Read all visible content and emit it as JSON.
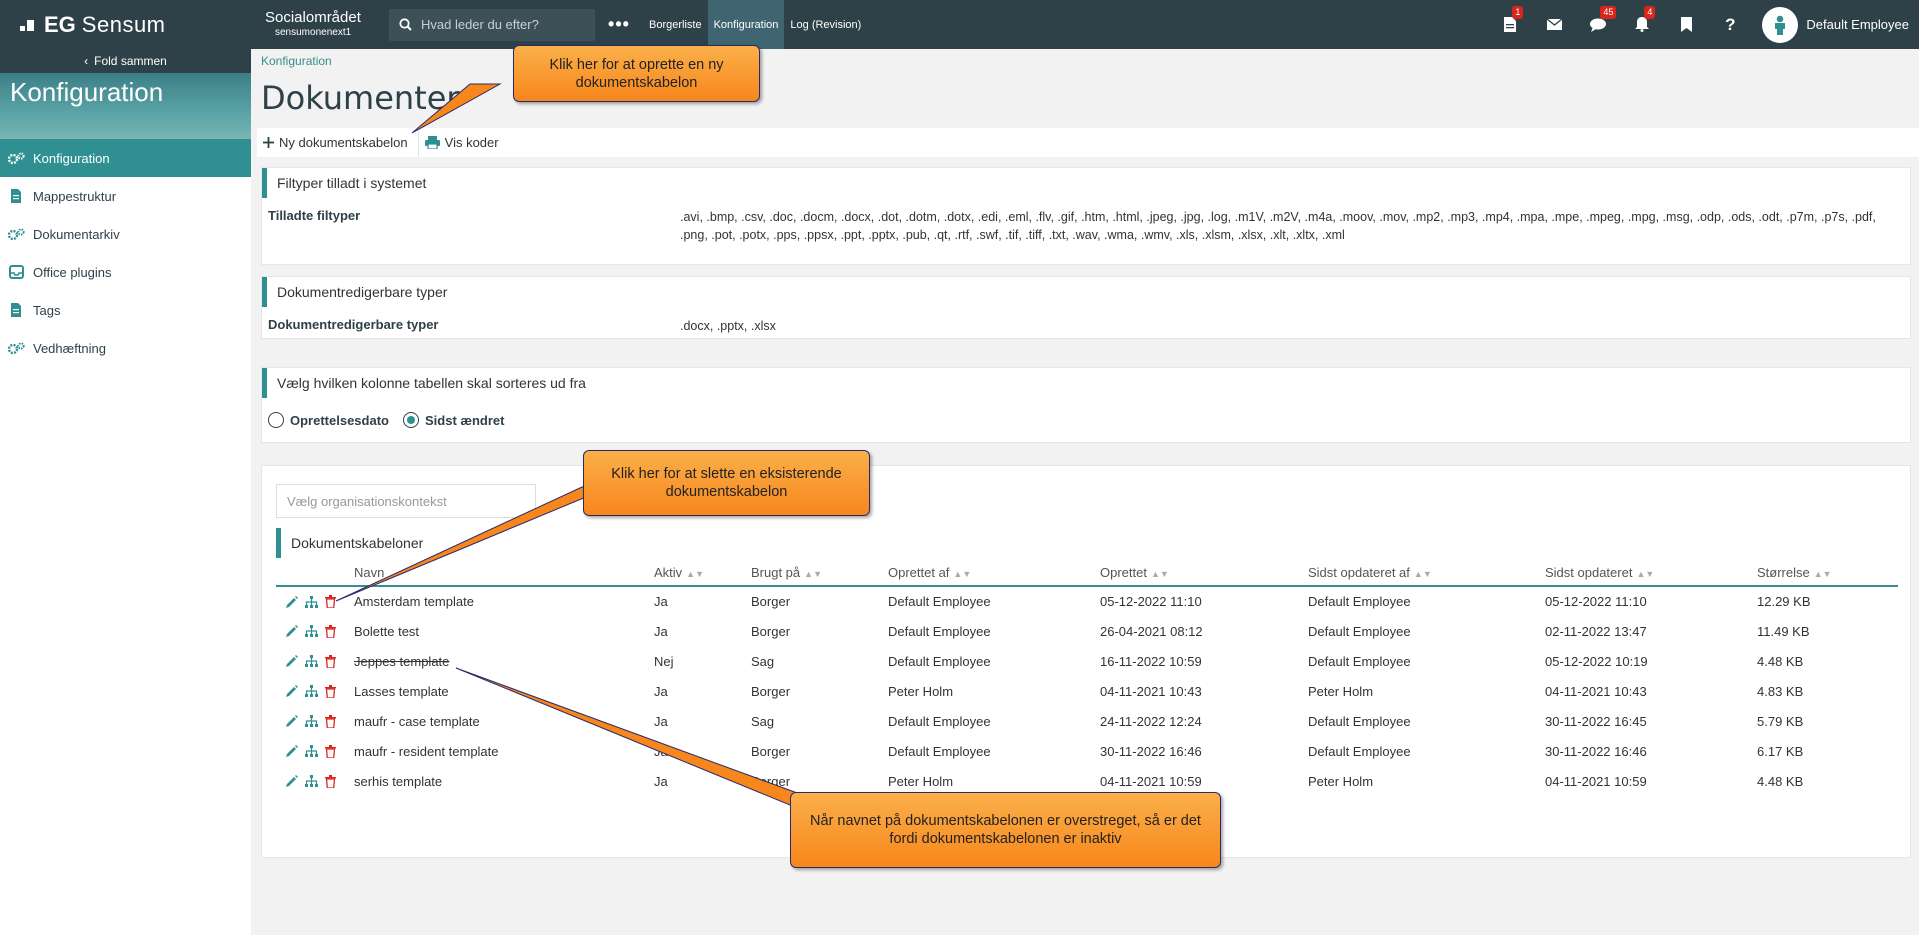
{
  "topbar": {
    "logo_eg": "EG",
    "logo_sensum": "Sensum",
    "org_title": "Socialområdet",
    "org_sub": "sensumonenext1",
    "search_placeholder": "Hvad leder du efter?",
    "more": "•••",
    "nav": [
      "Borgerliste",
      "Konfiguration",
      "Log (Revision)"
    ],
    "badges": {
      "docs": "1",
      "chat": "45",
      "bell": "4"
    },
    "user_name": "Default Employee"
  },
  "sidebar": {
    "fold_label": "Fold sammen",
    "banner_title": "Konfiguration",
    "items": [
      {
        "label": "Konfiguration",
        "icon": "gears-icon"
      },
      {
        "label": "Mappestruktur",
        "icon": "document-icon"
      },
      {
        "label": "Dokumentarkiv",
        "icon": "gears-icon"
      },
      {
        "label": "Office plugins",
        "icon": "inbox-icon"
      },
      {
        "label": "Tags",
        "icon": "document-icon"
      },
      {
        "label": "Vedhæftning",
        "icon": "gears-icon"
      }
    ]
  },
  "page": {
    "breadcrumb": "Konfiguration",
    "title": "Dokumenter",
    "toolbar": {
      "new_template": "Ny dokumentskabelon",
      "show_codes": "Vis koder"
    }
  },
  "filetypes": {
    "heading": "Filtyper tilladt i systemet",
    "label": "Tilladte filtyper",
    "value": ".avi, .bmp, .csv, .doc, .docm, .docx, .dot, .dotm, .dotx, .edi, .eml, .flv, .gif, .htm, .html, .jpeg, .jpg, .log, .m1V, .m2V, .m4a, .moov, .mov, .mp2, .mp3, .mp4, .mpa, .mpe, .mpeg, .mpg, .msg, .odp, .ods, .odt, .p7m, .p7s, .pdf, .png, .pot, .potx, .pps, .ppsx, .ppt, .pptx, .pub, .qt, .rtf, .swf, .tif, .tiff, .txt, .wav, .wma, .wmv, .xls, .xlsm, .xlsx, .xlt, .xltx, .xml"
  },
  "editable": {
    "heading": "Dokumentredigerbare typer",
    "label": "Dokumentredigerbare typer",
    "value": ".docx, .pptx, .xlsx"
  },
  "sorting": {
    "heading": "Vælg hvilken kolonne tabellen skal sorteres ud fra",
    "option1": "Oprettelsesdato",
    "option2": "Sidst ændret",
    "selected": "Sidst ændret"
  },
  "templates": {
    "org_placeholder": "Vælg organisationskontekst",
    "heading": "Dokumentskabeloner",
    "columns": [
      "Navn",
      "Aktiv",
      "Brugt på",
      "Oprettet af",
      "Oprettet",
      "Sidst opdateret af",
      "Sidst opdateret",
      "Størrelse"
    ],
    "rows": [
      {
        "name": "Amsterdam template",
        "active": "Ja",
        "used": "Borger",
        "created_by": "Default Employee",
        "created": "05-12-2022 11:10",
        "updated_by": "Default Employee",
        "updated": "05-12-2022 11:10",
        "size": "12.29 KB",
        "inactive": false
      },
      {
        "name": "Bolette test",
        "active": "Ja",
        "used": "Borger",
        "created_by": "Default Employee",
        "created": "26-04-2021 08:12",
        "updated_by": "Default Employee",
        "updated": "02-11-2022 13:47",
        "size": "11.49 KB",
        "inactive": false
      },
      {
        "name": "Jeppes template",
        "active": "Nej",
        "used": "Sag",
        "created_by": "Default Employee",
        "created": "16-11-2022 10:59",
        "updated_by": "Default Employee",
        "updated": "05-12-2022 10:19",
        "size": "4.48 KB",
        "inactive": true
      },
      {
        "name": "Lasses template",
        "active": "Ja",
        "used": "Borger",
        "created_by": "Peter Holm",
        "created": "04-11-2021 10:43",
        "updated_by": "Peter Holm",
        "updated": "04-11-2021 10:43",
        "size": "4.83 KB",
        "inactive": false
      },
      {
        "name": "maufr - case template",
        "active": "Ja",
        "used": "Sag",
        "created_by": "Default Employee",
        "created": "24-11-2022 12:24",
        "updated_by": "Default Employee",
        "updated": "30-11-2022 16:45",
        "size": "5.79 KB",
        "inactive": false
      },
      {
        "name": "maufr - resident template",
        "active": "Ja",
        "used": "Borger",
        "created_by": "Default Employee",
        "created": "30-11-2022 16:46",
        "updated_by": "Default Employee",
        "updated": "30-11-2022 16:46",
        "size": "6.17 KB",
        "inactive": false
      },
      {
        "name": "serhis template",
        "active": "Ja",
        "used": "Borger",
        "created_by": "Peter Holm",
        "created": "04-11-2021 10:59",
        "updated_by": "Peter Holm",
        "updated": "04-11-2021 10:59",
        "size": "4.48 KB",
        "inactive": false
      }
    ]
  },
  "callouts": {
    "new": "Klik her for at oprette en ny dokumentskabelon",
    "delete": "Klik her for at slette en eksisterende dokumentskabelon",
    "inactive": "Når navnet på dokumentskabelonen er overstreget, så er det fordi dokumentskabelonen er inaktiv"
  },
  "colors": {
    "teal": "#2f8f91",
    "dark": "#2f4148",
    "callout": "#f7861c",
    "badge": "#d9261c"
  }
}
